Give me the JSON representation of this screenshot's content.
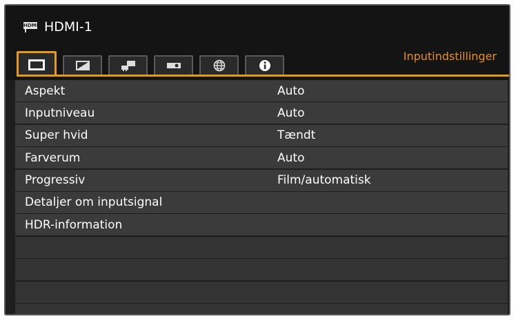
{
  "header": {
    "source_icon": "hdmi-input-icon",
    "source_icon_text": "HDMI",
    "source_label": "HDMI-1",
    "active_tab_title": "Inputindstillinger"
  },
  "tabs": [
    {
      "icon": "screen-icon",
      "active": true
    },
    {
      "icon": "image-adjust-icon",
      "active": false
    },
    {
      "icon": "installation-icon",
      "active": false
    },
    {
      "icon": "projector-icon",
      "active": false
    },
    {
      "icon": "globe-icon",
      "active": false
    },
    {
      "icon": "info-icon",
      "active": false
    }
  ],
  "menu": [
    {
      "label": "Aspekt",
      "value": "Auto"
    },
    {
      "label": "Inputniveau",
      "value": "Auto"
    },
    {
      "label": "Super hvid",
      "value": "Tændt"
    },
    {
      "label": "Farverum",
      "value": "Auto"
    },
    {
      "label": "Progressiv",
      "value": "Film/automatisk"
    },
    {
      "label": "Detaljer om inputsignal",
      "value": ""
    },
    {
      "label": "HDR-information",
      "value": ""
    }
  ],
  "colors": {
    "accent": "#e59a1c",
    "background": "#1e1e1e",
    "row": "#3b3b3b",
    "text": "#ffffff"
  }
}
